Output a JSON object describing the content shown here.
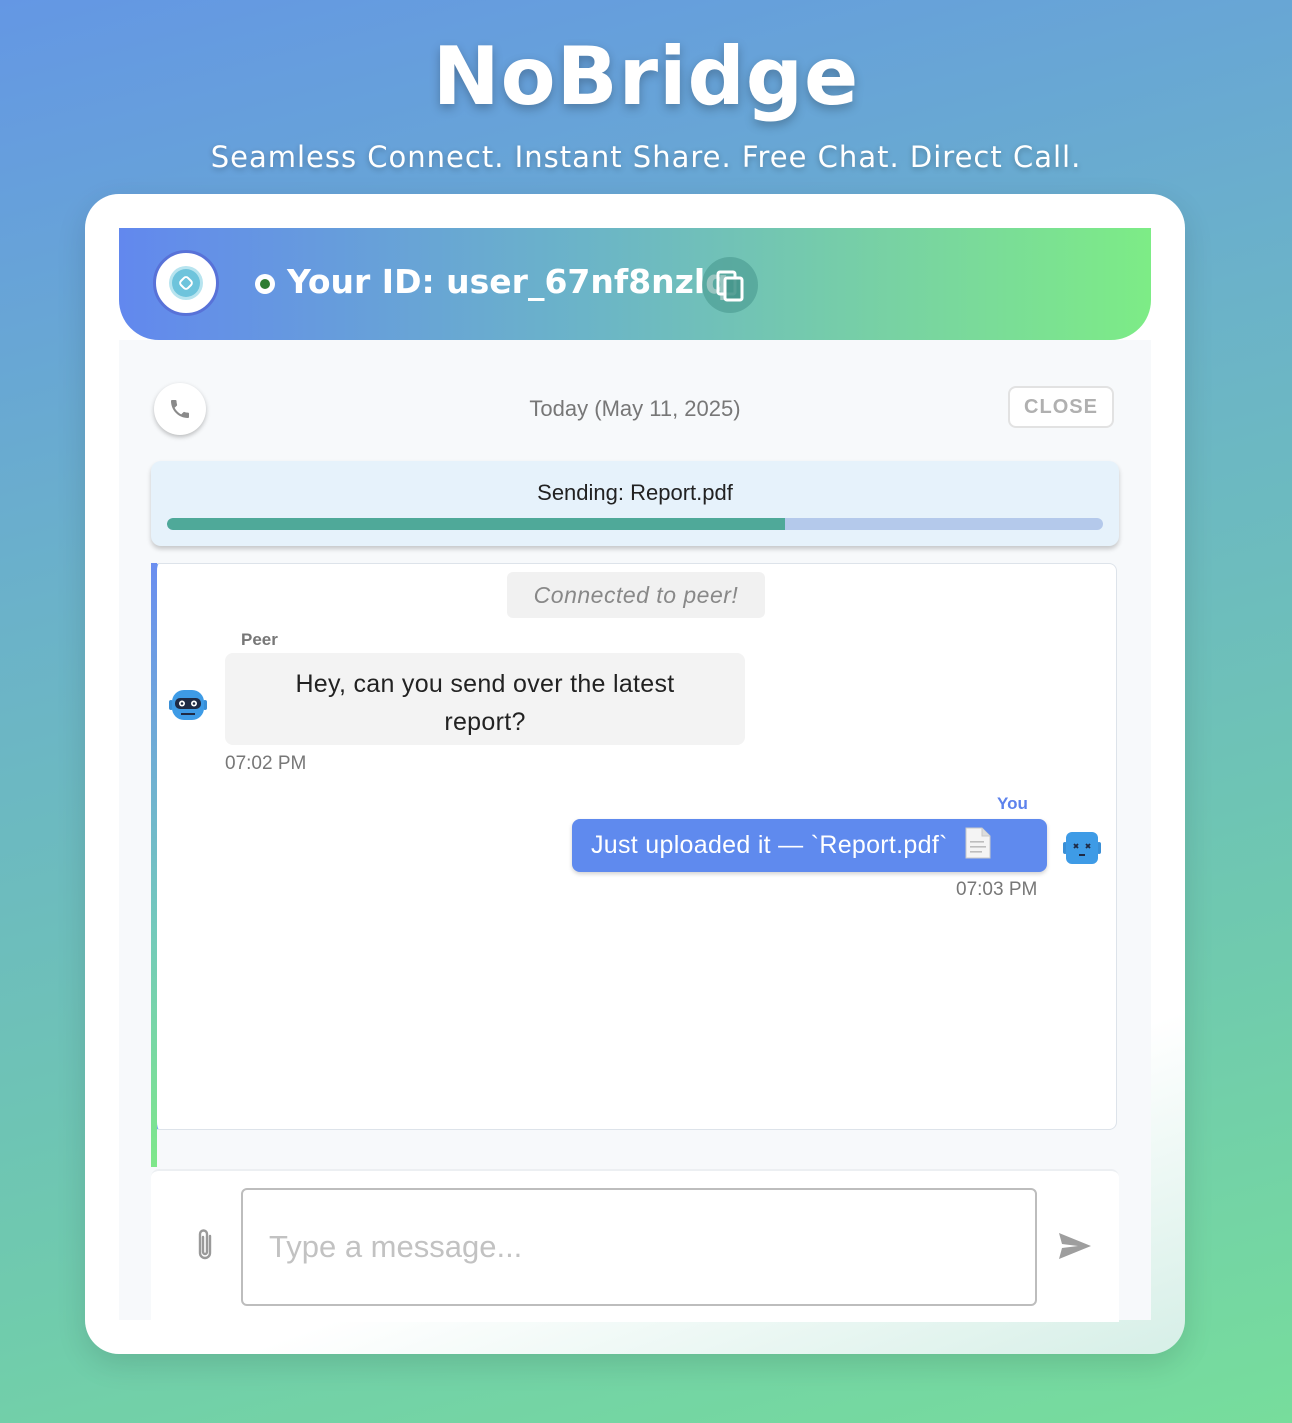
{
  "app": {
    "title": "NoBridge",
    "tagline": "Seamless Connect. Instant Share. Free Chat. Direct Call."
  },
  "header": {
    "your_id_label": "Your ID: user_67nf8nzlq",
    "status": "online",
    "icons": [
      "logo-icon",
      "status-dot-icon",
      "copy-icon"
    ]
  },
  "toolbar": {
    "date": "Today (May 11, 2025)",
    "close_label": "CLOSE",
    "call_icon": "phone-icon"
  },
  "transfer": {
    "label": "Sending: Report.pdf",
    "progress": 0.66
  },
  "messages": {
    "system": "Connected to peer!",
    "peer": {
      "name": "Peer",
      "text": "Hey, can you send over the latest report?",
      "time": "07:02 PM",
      "avatar": "robot-avatar-icon"
    },
    "you": {
      "name": "You",
      "text": "Just uploaded it — `Report.pdf`",
      "emoji": "document-icon",
      "time": "07:03 PM",
      "avatar": "robot-avatar-icon"
    }
  },
  "composer": {
    "placeholder": "Type a message...",
    "value": "",
    "attach_icon": "paperclip-icon",
    "send_icon": "send-icon"
  },
  "colors": {
    "accent": "#5f8aee",
    "progress_fill": "#4fa999",
    "progress_track": "#b4c9eb",
    "status_online": "#2e7d32"
  }
}
